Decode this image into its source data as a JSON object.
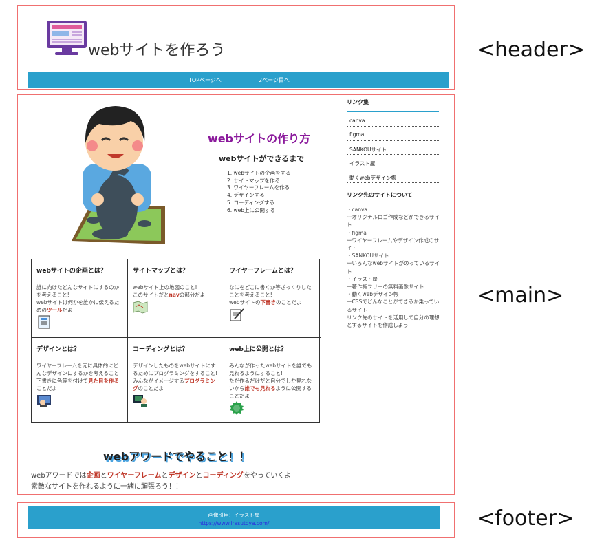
{
  "annotations": {
    "header_tag": "<header>",
    "main_tag": "<main>",
    "footer_tag": "<footer>"
  },
  "header": {
    "title": "webサイトを作ろう",
    "logo_icon": "computer-screen-icon",
    "nav": [
      "TOPページへ",
      "2ページ目へ"
    ]
  },
  "main": {
    "hero_title": "webサイトの作り方",
    "hero_subtitle": "webサイトができるまで",
    "steps": [
      "1. webサイトの企画をする",
      "2. サイトマップを作る",
      "3. ワイヤーフレームを作る",
      "4. デザインする",
      "5. コーディングする",
      "6. web上に公開する"
    ],
    "cards": [
      {
        "title": "webサイトの企画とは？",
        "t1": "誰に向けたどんなサイトにするのかを考えること!",
        "t2": "webサイトは何かを誰かに伝えるための",
        "hl": "ツール",
        "t3": "だよ",
        "icon": "document-icon"
      },
      {
        "title": "サイトマップとは？",
        "t1": "webサイト上の地図のこと!",
        "t2": "このサイトだと",
        "hl": "nav",
        "t3": "の部分だよ",
        "icon": "map-icon"
      },
      {
        "title": "ワイヤーフレームとは？",
        "t1": "なにをどこに書くか等ざっくりしたことを考えること!",
        "t2": "webサイトの",
        "hl": "下書き",
        "t3": "のことだよ",
        "icon": "pen-paper-icon"
      },
      {
        "title": "デザインとは？",
        "t1": "ワイヤーフレームを元に具体的にどんなデザインにするかを考えること!",
        "t2": "下書きに色等を付けて",
        "hl": "見た目を作る",
        "t3": "ことだよ",
        "icon": "designer-icon"
      },
      {
        "title": "コーディングとは？",
        "t1": "デザインしたものをwebサイトにするためにプログラミングをすること!",
        "t2": "みんながイメージする",
        "hl": "プログラミング",
        "t3": "のことだよ",
        "icon": "programmer-icon"
      },
      {
        "title": "web上に公開とは？",
        "t1": "みんなが作ったwebサイトを誰でも見れるようにすること!",
        "t2": "ただ作るだけだと自分でしか見れないから",
        "hl": "誰でも見れる",
        "t3": "ように公開することだよ",
        "icon": "publish-badge-icon"
      }
    ],
    "award_title": "webアワードでやること！！",
    "award_text": {
      "p1": "webアワードでは",
      "h1": "企画",
      "p2": "と",
      "h2": "ワイヤーフレーム",
      "p3": "と",
      "h3": "デザイン",
      "p4": "と",
      "h4": "コーディング",
      "p5": "をやっていくよ",
      "p6": "素敵なサイトを作れるように一緒に頑張ろう！！"
    }
  },
  "sidebar": {
    "links_heading": "リンク集",
    "links": [
      "canva",
      "figma",
      "SANKOUサイト",
      "イラスト屋",
      "動くwebデザイン帳"
    ],
    "about_heading": "リンク先のサイトについて",
    "about_lines": [
      "・canva",
      "ーオリジナルロゴ作成などができるサイト",
      "・figma",
      "ーワイヤーフレームやデザイン作成のサイト",
      "・SANKOUサイト",
      "ーいろんなwebサイトがのっているサイト",
      "・イラスト屋",
      "ー著作権フリーの無料画像サイト",
      "・動くwebデザイン帳",
      "ーCSSでどんなことができるか乗っているサイト",
      "リンク先のサイトを活用して自分の理想とするサイトを作成しよう"
    ]
  },
  "footer": {
    "credit": "画像引用：イラスト屋",
    "url": "https://www.irasutoya.com/"
  },
  "colors": {
    "frame": "#f07070",
    "nav_bg": "#2aa0cc",
    "hero_title": "#8b1a9c",
    "highlight": "#c0392b"
  }
}
